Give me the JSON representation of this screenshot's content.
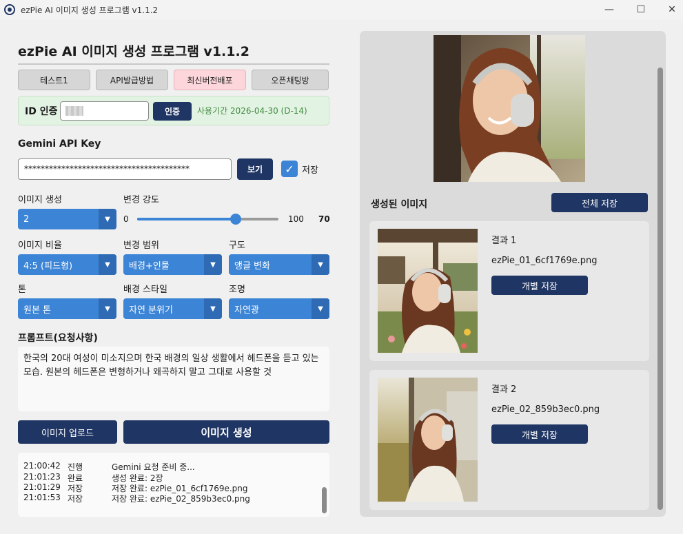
{
  "window": {
    "title": "ezPie AI 이미지 생성 프로그램 v1.1.2"
  },
  "header": {
    "title": "ezPie AI 이미지 생성 프로그램 v1.1.2"
  },
  "tabs": [
    "테스트1",
    "API발급방법",
    "최신버전배포",
    "오픈채팅방"
  ],
  "auth": {
    "label": "ID 인증",
    "button": "인증",
    "period": "사용기간 2026-04-30 (D-14)"
  },
  "api": {
    "label": "Gemini API Key",
    "value": "****************************************",
    "show_button": "보기",
    "save_label": "저장",
    "save_checked": true
  },
  "options": {
    "count_label": "이미지 생성",
    "count_value": "2",
    "strength_label": "변경 강도",
    "strength_min": "0",
    "strength_max": "100",
    "strength_value": "70",
    "ratio_label": "이미지 비율",
    "ratio_value": "4:5 (피드형)",
    "scope_label": "변경 범위",
    "scope_value": "배경+인물",
    "composition_label": "구도",
    "composition_value": "앵글 변화",
    "tone_label": "톤",
    "tone_value": "원본 톤",
    "bg_style_label": "배경 스타일",
    "bg_style_value": "자연 분위기",
    "lighting_label": "조명",
    "lighting_value": "자연광"
  },
  "prompt": {
    "label": "프롬프트(요청사항)",
    "text": "한국의 20대 여성이 미소지으며 한국 배경의 일상 생활에서 헤드폰을 듣고 있는 모습. 원본의 헤드폰은 변형하거나 왜곡하지 말고 그대로 사용할 것"
  },
  "actions": {
    "upload": "이미지 업로드",
    "generate": "이미지 생성"
  },
  "log": [
    {
      "time": "21:00:42",
      "status": "진행",
      "msg": "Gemini 요청 준비 중..."
    },
    {
      "time": "21:01:23",
      "status": "완료",
      "msg": "생성 완료: 2장"
    },
    {
      "time": "21:01:29",
      "status": "저장",
      "msg": "저장 완료: ezPie_01_6cf1769e.png"
    },
    {
      "time": "21:01:53",
      "status": "저장",
      "msg": "저장 완료: ezPie_02_859b3ec0.png"
    }
  ],
  "results": {
    "label": "생성된 이미지",
    "save_all": "전체 저장",
    "items": [
      {
        "title": "결과 1",
        "filename": "ezPie_01_6cf1769e.png",
        "save": "개별 저장"
      },
      {
        "title": "결과 2",
        "filename": "ezPie_02_859b3ec0.png",
        "save": "개별 저장"
      }
    ]
  },
  "colors": {
    "accent": "#3c84d6",
    "navy": "#1f3563",
    "auth_bg": "#e3f3e3",
    "pink_tab": "#fcd6da"
  }
}
